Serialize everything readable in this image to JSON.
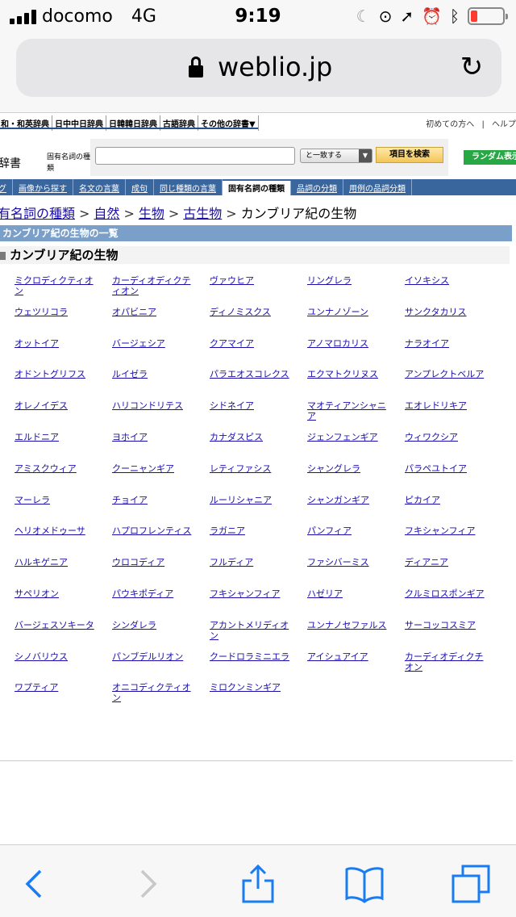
{
  "status_bar": {
    "carrier": "docomo",
    "network": "4G",
    "time": "9:19",
    "battery_level": 0.2
  },
  "browser": {
    "url": "weblio.jp"
  },
  "header": {
    "dict_tabs": [
      "和・和英辞典",
      "日中中日辞典",
      "日韓韓日辞典",
      "古語辞典",
      "その他の辞書▼"
    ],
    "top_links": [
      "初めての方へ",
      "|",
      "ヘルプ"
    ],
    "logo_text": "辞書",
    "search_label": "固有名詞の種類",
    "search_value": "",
    "match_option": "と一致する",
    "search_button": "項目を検索",
    "random_button": "ランダム表示"
  },
  "nav": [
    "グ",
    "画像から探す",
    "名文の言葉",
    "成句",
    "同じ種類の言葉",
    "固有名詞の種類",
    "品詞の分類",
    "用例の品詞分類"
  ],
  "breadcrumb": [
    "有名詞の種類",
    "自然",
    "生物",
    "古生物",
    "カンブリア紀の生物"
  ],
  "list_heading": "カンブリア紀の生物の一覧",
  "section_title": "カンブリア紀の生物",
  "items": [
    "ミクロディクティオン",
    "カーディオディクティオン",
    "ヴァウヒア",
    "リングレラ",
    "イソキシス",
    "ウェツリコラ",
    "オパビニア",
    "ディノミスクス",
    "ユンナノゾーン",
    "サンクタカリス",
    "オットイア",
    "バージェシア",
    "クアマイア",
    "アノマロカリス",
    "ナラオイア",
    "オドントグリフス",
    "ルイゼラ",
    "パラエオスコレクス",
    "エクマトクリヌス",
    "アンプレクトベルア",
    "オレノイデス",
    "ハリコンドリテス",
    "シドネイア",
    "マオティアンシャニア",
    "エオレドリキア",
    "エルドニア",
    "ヨホイア",
    "カナダスピス",
    "ジェンフェンギア",
    "ウィワクシア",
    "アミスクウィア",
    "クーニャンギア",
    "レティファシス",
    "シャングレラ",
    "パラペユトイア",
    "マーレラ",
    "チョイア",
    "ルーリシャニア",
    "シャンガンギア",
    "ピカイア",
    "ヘリオメドゥーサ",
    "ハプロフレンティス",
    "ラガニア",
    "パンフィア",
    "フキシャンフィア",
    "ハルキゲニア",
    "ウロコディア",
    "フルディア",
    "ファシバーミス",
    "ディアニア",
    "サペリオン",
    "パウキポディア",
    "フキシャンフィア",
    "ハゼリア",
    "クルミロスポンギア",
    "バージェスソキータ",
    "シンダレラ",
    "アカントメリディオン",
    "ユンナノセファルス",
    "サーコッコスミア",
    "シノバリウス",
    "パンブデルリオン",
    "クードロラミニエラ",
    "アイシュアイア",
    "カーディオディクチオン",
    "ワプティア",
    "オニコディクティオン",
    "ミロクンミンギア"
  ],
  "toolbar": [
    "back-icon",
    "forward-icon",
    "share-icon",
    "bookmarks-icon",
    "tabs-icon"
  ]
}
